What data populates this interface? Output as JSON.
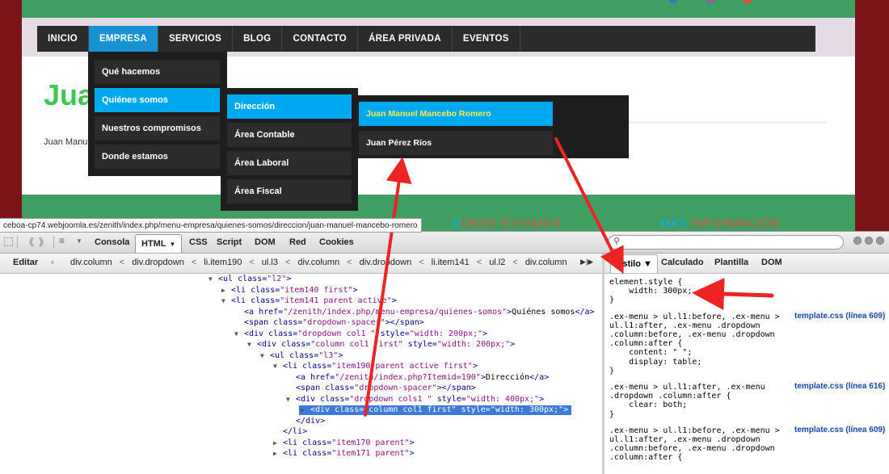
{
  "site": {
    "nav": [
      {
        "label": "INICIO",
        "active": false
      },
      {
        "label": "EMPRESA",
        "active": true
      },
      {
        "label": "SERVICIOS",
        "active": false
      },
      {
        "label": "BLOG",
        "active": false
      },
      {
        "label": "CONTACTO",
        "active": false
      },
      {
        "label": "ÁREA PRIVADA",
        "active": false
      },
      {
        "label": "EVENTOS",
        "active": false
      }
    ],
    "heading": "Jua",
    "subtext": "Juan Manu",
    "dropdown1": [
      "Qué hacemos",
      "Quiénes somos",
      "Nuestros compromisos",
      "Donde estamos"
    ],
    "dropdown2": [
      "Dirección",
      "Área Contable",
      "Área Laboral",
      "Área Fiscal"
    ],
    "dropdown3": [
      "Juan Manuel Mancebo Romero",
      "Juan Pérez Ríos"
    ],
    "footer_link_1": {
      "hl": "D",
      "p1": "ÓNDE ",
      "p2": "ESTAMOS"
    },
    "footer_link_2": {
      "hl": "MÁS ",
      "p1": "INFORMACIÓN"
    },
    "status_url": "ceboa-cp74.webjoomla.es/zenith/index.php/menu-empresa/quienes-somos/direccion/juan-manuel-mancebo-romero",
    "colors": {
      "menu_active": "#00a8f0",
      "heading": "#44c454",
      "green_band": "#3f9f63",
      "frame": "#7a1418"
    }
  },
  "devtools": {
    "tabs": [
      {
        "label": "Consola",
        "active": false
      },
      {
        "label": "HTML",
        "active": true,
        "caret": "▼"
      },
      {
        "label": "CSS",
        "active": false
      },
      {
        "label": "Script",
        "active": false
      },
      {
        "label": "DOM",
        "active": false
      },
      {
        "label": "Red",
        "active": false
      },
      {
        "label": "Cookies",
        "active": false
      }
    ],
    "search_placeholder": "",
    "breadcrumb_edit": "Editar",
    "breadcrumbs": [
      "div.column",
      "div.dropdown",
      "li.item190",
      "ul.l3",
      "div.column",
      "div.dropdown",
      "li.item141",
      "ul.l2",
      "div.column"
    ],
    "side_tabs": [
      "Estilo ▼",
      "Calculado",
      "Plantilla",
      "DOM"
    ],
    "html_lines": [
      {
        "indent": 0,
        "twisty": "▼",
        "html": "<span class='tag'>&lt;ul</span> <span class='attr'>class=</span><span class='val'>\"l2\"</span><span class='tag'>&gt;</span>"
      },
      {
        "indent": 1,
        "twisty": "▶",
        "html": "<span class='tag'>&lt;li</span> <span class='attr'>class=</span><span class='val'>\"item140 first\"</span><span class='tag'>&gt;</span>"
      },
      {
        "indent": 1,
        "twisty": "▼",
        "html": "<span class='tag'>&lt;li</span> <span class='attr'>class=</span><span class='val'>\"item141 parent active\"</span><span class='tag'>&gt;</span>"
      },
      {
        "indent": 2,
        "twisty": "",
        "html": "<span class='tag'>&lt;a</span> <span class='attr'>href=</span><span class='val'>\"/zenith/index.php/menu-empresa/quienes-somos\"</span><span class='tag'>&gt;</span><span class='txt'>Quiénes somos</span><span class='tag'>&lt;/a&gt;</span>"
      },
      {
        "indent": 2,
        "twisty": "",
        "html": "<span class='tag'>&lt;span</span> <span class='attr'>class=</span><span class='val'>\"dropdown-spacer\"</span><span class='tag'>&gt;&lt;/span&gt;</span>"
      },
      {
        "indent": 2,
        "twisty": "▼",
        "html": "<span class='tag'>&lt;div</span> <span class='attr'>class=</span><span class='val'>\"dropdown col1 \"</span> <span class='attr'>style=</span><span class='val'>\"width: 200px;\"</span><span class='tag'>&gt;</span>"
      },
      {
        "indent": 3,
        "twisty": "▼",
        "html": "<span class='tag'>&lt;div</span> <span class='attr'>class=</span><span class='val'>\"column col1 first\"</span> <span class='attr'>style=</span><span class='val'>\"width: 200px;\"</span><span class='tag'>&gt;</span>"
      },
      {
        "indent": 4,
        "twisty": "▼",
        "html": "<span class='tag'>&lt;ul</span> <span class='attr'>class=</span><span class='val'>\"l3\"</span><span class='tag'>&gt;</span>"
      },
      {
        "indent": 5,
        "twisty": "▼",
        "html": "<span class='tag'>&lt;li</span> <span class='attr'>class=</span><span class='val'>\"item190 parent active first\"</span><span class='tag'>&gt;</span>"
      },
      {
        "indent": 6,
        "twisty": "",
        "html": "<span class='tag'>&lt;a</span> <span class='attr'>href=</span><span class='val'>\"/zenith/index.php?Itemid=190\"</span><span class='tag'>&gt;</span><span class='txt'>Dirección</span><span class='tag'>&lt;/a&gt;</span>"
      },
      {
        "indent": 6,
        "twisty": "",
        "html": "<span class='tag'>&lt;span</span> <span class='attr'>class=</span><span class='val'>\"dropdown-spacer\"</span><span class='tag'>&gt;&lt;/span&gt;</span>"
      },
      {
        "indent": 6,
        "twisty": "▼",
        "html": "<span class='tag'>&lt;div</span> <span class='attr'>class=</span><span class='val'>\"dropdown cols1 \"</span> <span class='attr'>style=</span><span class='val'>\"width: 400px;\"</span><span class='tag'>&gt;</span>"
      },
      {
        "indent": 7,
        "twisty": "▶",
        "sel": true,
        "html": "<span class='tag'>&lt;div</span> <span class='attr'>class=</span><span class='val'>\"column col1 first\"</span> <span class='attr'>style=</span><span class='val'>\"width: 300px;\"</span><span class='tag'>&gt;</span>"
      },
      {
        "indent": 6,
        "twisty": "",
        "html": "<span class='tag'>&lt;/div&gt;</span>"
      },
      {
        "indent": 5,
        "twisty": "",
        "html": "<span class='tag'>&lt;/li&gt;</span>"
      },
      {
        "indent": 5,
        "twisty": "▶",
        "html": "<span class='tag'>&lt;li</span> <span class='attr'>class=</span><span class='val'>\"item170 parent\"</span><span class='tag'>&gt;</span>"
      },
      {
        "indent": 5,
        "twisty": "▶",
        "html": "<span class='tag'>&lt;li</span> <span class='attr'>class=</span><span class='val'>\"item171 parent\"</span><span class='tag'>&gt;</span>"
      }
    ],
    "css_rules": [
      {
        "lines": [
          "element.style {",
          "    width: 300px;",
          "}"
        ],
        "source": ""
      },
      {
        "lines": [
          ".ex-menu > ul.l1:before, .ex-menu >",
          "ul.l1:after, .ex-menu .dropdown",
          ".column:before, .ex-menu .dropdown",
          ".column:after {",
          "    content: \" \";",
          "    display: table;",
          "}"
        ],
        "source": "template.css (línea 609)"
      },
      {
        "lines": [
          ".ex-menu > ul.l1:after, .ex-menu",
          ".dropdown .column:after {",
          "    clear: both;",
          "}"
        ],
        "source": "template.css (línea 616)"
      },
      {
        "lines": [
          ".ex-menu > ul.l1:before, .ex-menu >",
          "ul.l1:after, .ex-menu .dropdown",
          ".column:before, .ex-menu .dropdown",
          ".column:after {"
        ],
        "source": "template.css (línea 609)"
      }
    ]
  }
}
